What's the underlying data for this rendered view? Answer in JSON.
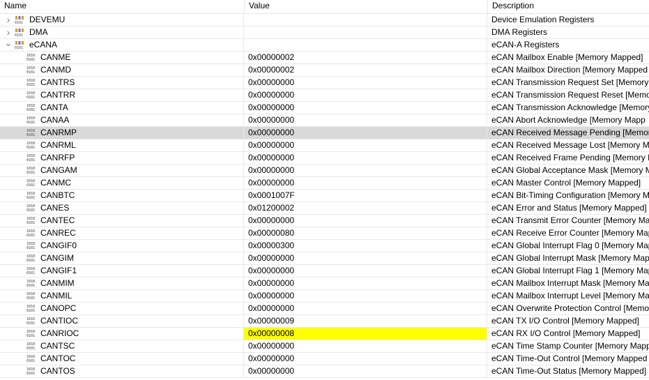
{
  "columns": {
    "name": "Name",
    "value": "Value",
    "description": "Description"
  },
  "icons": {
    "group": "register-group-icon",
    "register": "register-bits-icon",
    "collapsed": "chevron-right-icon",
    "expanded": "chevron-down-icon"
  },
  "colors": {
    "selected_row": "#d9d9d9",
    "changed_value": "#ffff00"
  },
  "groups": [
    {
      "name": "DEVEMU",
      "value": "",
      "description": "Device Emulation Registers",
      "expanded": false
    },
    {
      "name": "DMA",
      "value": "",
      "description": "DMA Registers",
      "expanded": false
    },
    {
      "name": "eCANA",
      "value": "",
      "description": "eCAN-A  Registers",
      "expanded": true
    }
  ],
  "registers": [
    {
      "name": "CANME",
      "value": "0x00000002",
      "description": "eCAN Mailbox Enable [Memory Mapped]"
    },
    {
      "name": "CANMD",
      "value": "0x00000002",
      "description": "eCAN Mailbox Direction [Memory Mapped"
    },
    {
      "name": "CANTRS",
      "value": "0x00000000",
      "description": "eCAN Transmission Request Set [Memory M"
    },
    {
      "name": "CANTRR",
      "value": "0x00000000",
      "description": "eCAN Transmission Request Reset [Memory"
    },
    {
      "name": "CANTA",
      "value": "0x00000000",
      "description": "eCAN Transmission Acknowledge [Memory"
    },
    {
      "name": "CANAA",
      "value": "0x00000000",
      "description": "eCAN Abort Acknowledge [Memory Mapp"
    },
    {
      "name": "CANRMP",
      "value": "0x00000000",
      "description": "eCAN Received Message Pending [Memory",
      "selected": true
    },
    {
      "name": "CANRML",
      "value": "0x00000000",
      "description": "eCAN Received Message Lost [Memory Ma"
    },
    {
      "name": "CANRFP",
      "value": "0x00000000",
      "description": "eCAN Received Frame Pending [Memory M"
    },
    {
      "name": "CANGAM",
      "value": "0x00000000",
      "description": "eCAN Global Acceptance Mask [Memory M"
    },
    {
      "name": "CANMC",
      "value": "0x00000000",
      "description": "eCAN Master Control [Memory Mapped]"
    },
    {
      "name": "CANBTC",
      "value": "0x0001007F",
      "description": "eCAN Bit-Timing Configuration [Memory M"
    },
    {
      "name": "CANES",
      "value": "0x01200002",
      "description": "eCAN Error and Status [Memory Mapped]"
    },
    {
      "name": "CANTEC",
      "value": "0x00000000",
      "description": "eCAN Transmit Error Counter [Memory Ma"
    },
    {
      "name": "CANREC",
      "value": "0x00000080",
      "description": "eCAN Receive Error Counter [Memory Map"
    },
    {
      "name": "CANGIF0",
      "value": "0x00000300",
      "description": "eCAN Global Interrupt Flag 0 [Memory Map"
    },
    {
      "name": "CANGIM",
      "value": "0x00000000",
      "description": "eCAN Global Interrupt Mask [Memory Map"
    },
    {
      "name": "CANGIF1",
      "value": "0x00000000",
      "description": "eCAN Global Interrupt Flag 1 [Memory Map"
    },
    {
      "name": "CANMIM",
      "value": "0x00000000",
      "description": "eCAN Mailbox Interrupt Mask [Memory Ma"
    },
    {
      "name": "CANMIL",
      "value": "0x00000000",
      "description": "eCAN Mailbox Interrupt Level [Memory Ma"
    },
    {
      "name": "CANOPC",
      "value": "0x00000000",
      "description": "eCAN Overwrite Protection Control [Memo"
    },
    {
      "name": "CANTIOC",
      "value": "0x00000009",
      "description": "eCAN TX I/O Control [Memory Mapped]"
    },
    {
      "name": "CANRIOC",
      "value": "0x00000008",
      "description": "eCAN RX I/O Control [Memory Mapped]",
      "changed": true
    },
    {
      "name": "CANTSC",
      "value": "0x00000000",
      "description": "eCAN Time Stamp Counter [Memory Mapp"
    },
    {
      "name": "CANTOC",
      "value": "0x00000000",
      "description": "eCAN Time-Out Control [Memory Mapped"
    },
    {
      "name": "CANTOS",
      "value": "0x00000000",
      "description": "eCAN Time-Out Status [Memory Mapped]"
    }
  ]
}
